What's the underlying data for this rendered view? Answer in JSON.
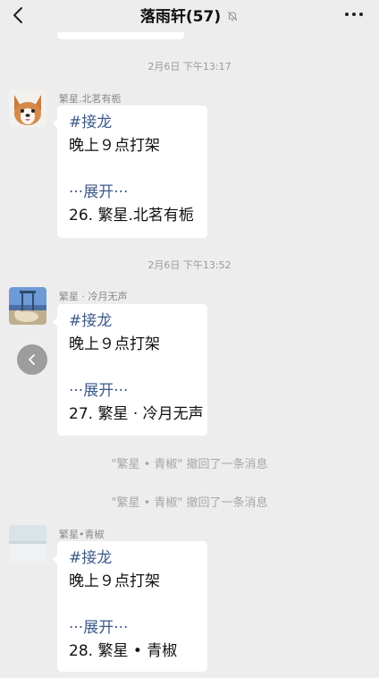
{
  "header": {
    "title": "落雨轩(57)"
  },
  "messages": [
    {
      "timestamp": "2月6日 下午13:17",
      "sender": "繁星.北茗有栀",
      "tag": "#接龙",
      "body": "晚上９点打架",
      "expand": "···展开···",
      "entry": "26. 繁星.北茗有栀"
    },
    {
      "timestamp": "2月6日 下午13:52",
      "sender": "繁星 · 冷月无声",
      "tag": "#接龙",
      "body": "晚上９点打架",
      "expand": "···展开···",
      "entry": "27. 繁星 · 冷月无声"
    },
    {
      "sender": "繁星•青椒",
      "tag": "#接龙",
      "body": "晚上９点打架",
      "expand": "···展开···",
      "entry": "28. 繁星 • 青椒"
    }
  ],
  "recall_notices": [
    "\"繁星 • 青椒\" 撤回了一条消息",
    "\"繁星 • 青椒\" 撤回了一条消息"
  ]
}
